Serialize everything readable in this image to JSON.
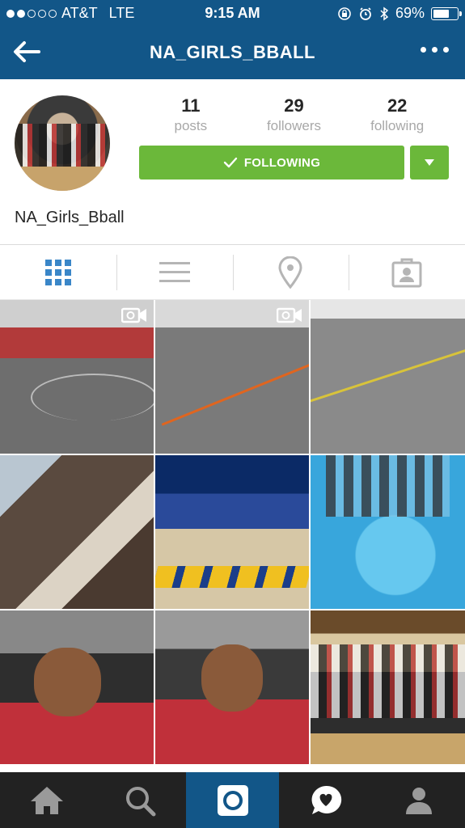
{
  "status_bar": {
    "carrier": "AT&T",
    "network": "LTE",
    "time": "9:15 AM",
    "battery_percent": "69%",
    "battery_level": 0.69,
    "signal_dots_filled": 2,
    "signal_dots_total": 5
  },
  "header": {
    "title": "NA_GIRLS_BBALL",
    "back_icon": "arrow-left-icon",
    "more_icon": "more-horizontal-icon",
    "background_color": "#125688"
  },
  "profile": {
    "stats": [
      {
        "value": "11",
        "label": "posts"
      },
      {
        "value": "29",
        "label": "followers"
      },
      {
        "value": "22",
        "label": "following"
      }
    ],
    "follow_button_label": "FOLLOWING",
    "follow_button_color": "#6bb83a",
    "display_name": "NA_Girls_Bball"
  },
  "view_tabs": [
    {
      "name": "grid-view",
      "icon": "grid-icon",
      "active": true
    },
    {
      "name": "list-view",
      "icon": "list-icon",
      "active": false
    },
    {
      "name": "map-view",
      "icon": "location-pin-icon",
      "active": false
    },
    {
      "name": "tagged-view",
      "icon": "tagged-person-icon",
      "active": false
    }
  ],
  "photos": [
    {
      "id": "photo-1",
      "is_video": true
    },
    {
      "id": "photo-2",
      "is_video": true
    },
    {
      "id": "photo-3",
      "is_video": false
    },
    {
      "id": "photo-4",
      "is_video": false
    },
    {
      "id": "photo-5",
      "is_video": false
    },
    {
      "id": "photo-6",
      "is_video": false
    },
    {
      "id": "photo-7",
      "is_video": false
    },
    {
      "id": "photo-8",
      "is_video": false
    },
    {
      "id": "photo-9",
      "is_video": false
    }
  ],
  "bottom_nav": [
    {
      "name": "home",
      "icon": "home-icon",
      "active": false
    },
    {
      "name": "search",
      "icon": "search-icon",
      "active": false
    },
    {
      "name": "camera",
      "icon": "camera-icon",
      "active": true
    },
    {
      "name": "activity",
      "icon": "heart-bubble-icon",
      "active": false
    },
    {
      "name": "profile",
      "icon": "person-icon",
      "active": false
    }
  ]
}
